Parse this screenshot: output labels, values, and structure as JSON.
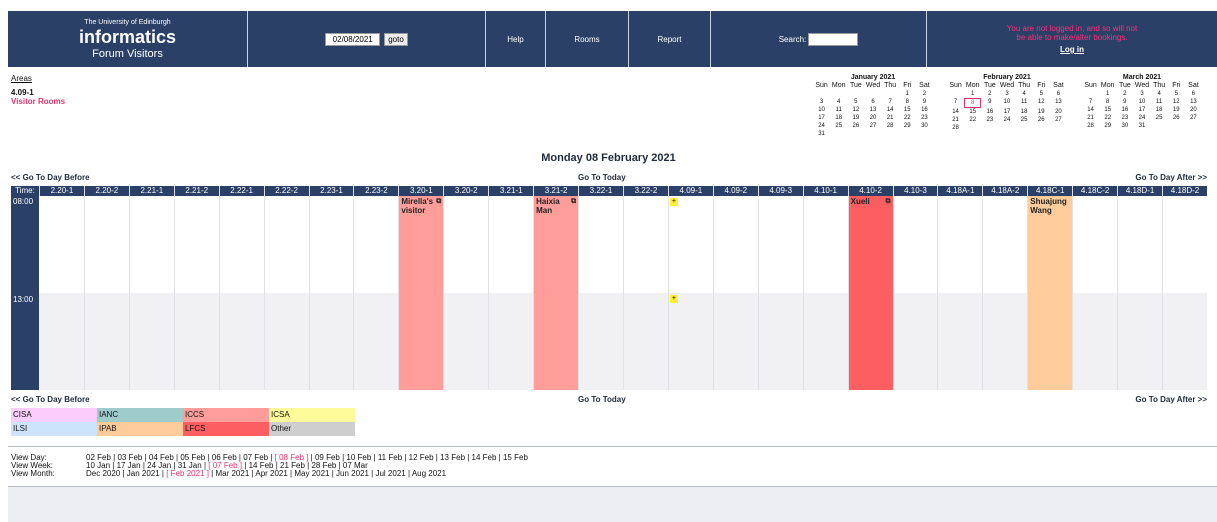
{
  "banner": {
    "university": "The University of Edinburgh",
    "brand": "informatics",
    "site": "Forum Visitors",
    "date_value": "02/08/2021",
    "goto_label": "goto",
    "nav": [
      "Help",
      "Rooms",
      "Report"
    ],
    "search_label": "Search:",
    "login_notice": "You are not logged in, and so will not be able to make/alter bookings.",
    "login_link": "Log in"
  },
  "areas": {
    "link": "Areas",
    "room": "4.09-1",
    "group": "Visitor Rooms"
  },
  "minicals": [
    {
      "title": "January 2021",
      "start": 5,
      "days": 31,
      "today": 0
    },
    {
      "title": "February 2021",
      "start": 1,
      "days": 28,
      "today": 8
    },
    {
      "title": "March 2021",
      "start": 1,
      "days": 31,
      "today": 0
    }
  ],
  "day_headers": [
    "Sun",
    "Mon",
    "Tue",
    "Wed",
    "Thu",
    "Fri",
    "Sat"
  ],
  "page_title": "Monday 08 February 2021",
  "nav": {
    "before": "<< Go To Day Before",
    "today": "Go To Today",
    "after": "Go To Day After >>"
  },
  "time_label": "Time:",
  "columns": [
    "2.20-1",
    "2.20-2",
    "2.21-1",
    "2.21-2",
    "2.22-1",
    "2.22-2",
    "2.23-1",
    "2.23-2",
    "3.20-1",
    "3.20-2",
    "3.21-1",
    "3.21-2",
    "3.22-1",
    "3.22-2",
    "4.09-1",
    "4.09-2",
    "4.09-3",
    "4.10-1",
    "4.10-2",
    "4.10-3",
    "4.18A-1",
    "4.18A-2",
    "4.18C-1",
    "4.18C-2",
    "4.18D-1",
    "4.18D-2"
  ],
  "slots": [
    "08:00",
    "13:00"
  ],
  "bookings": [
    {
      "col": 8,
      "text": "Mirella's visitor",
      "color": "#fe9d9a",
      "icon": true
    },
    {
      "col": 11,
      "text": "Haixia Man",
      "color": "#fe9d9a",
      "icon": true
    },
    {
      "col": 18,
      "text": "Xueli",
      "color": "#fc5e61",
      "icon": true
    },
    {
      "col": 22,
      "text": "Shuajung Wang",
      "color": "#fecc9a",
      "icon": false
    }
  ],
  "plus_col": 14,
  "plus_symbol": "+",
  "legend": [
    {
      "label": "CISA",
      "color": "#fccdfc"
    },
    {
      "label": "IANC",
      "color": "#9fcbcb"
    },
    {
      "label": "ICCS",
      "color": "#fe9d9a"
    },
    {
      "label": "ICSA",
      "color": "#fefb9a"
    },
    {
      "label": "ILSI",
      "color": "#cde4fd"
    },
    {
      "label": "IPAB",
      "color": "#fecc9a"
    },
    {
      "label": "LFCS",
      "color": "#fc5e61"
    },
    {
      "label": "Other",
      "color": "#cecece"
    }
  ],
  "views": [
    {
      "label": "View Day:",
      "items": [
        "02 Feb",
        "03 Feb",
        "04 Feb",
        "05 Feb",
        "06 Feb",
        "07 Feb",
        "[ 08 Feb ]",
        "09 Feb",
        "10 Feb",
        "11 Feb",
        "12 Feb",
        "13 Feb",
        "14 Feb",
        "15 Feb"
      ],
      "current": 6
    },
    {
      "label": "View Week:",
      "items": [
        "10 Jan",
        "17 Jan",
        "24 Jan",
        "31 Jan",
        "[ 07 Feb ]",
        "14 Feb",
        "21 Feb",
        "28 Feb",
        "07 Mar"
      ],
      "current": 4
    },
    {
      "label": "View Month:",
      "items": [
        "Dec 2020",
        "Jan 2021",
        "[ Feb 2021 ]",
        "Mar 2021",
        "Apr 2021",
        "May 2021",
        "Jun 2021",
        "Jul 2021",
        "Aug 2021"
      ],
      "current": 2
    }
  ]
}
